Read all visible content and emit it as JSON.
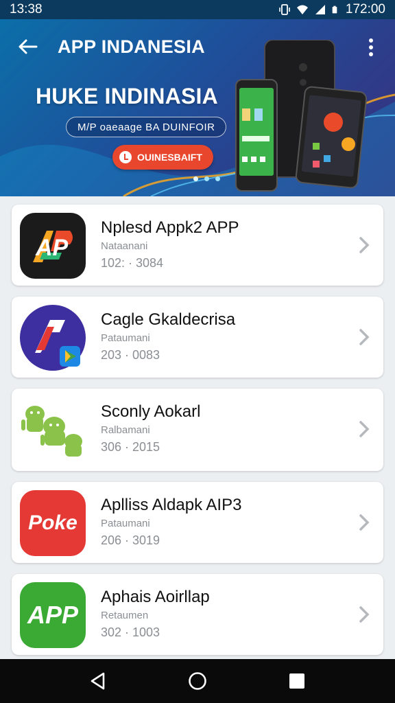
{
  "status_bar": {
    "time": "13:38",
    "clock_right": "172:00",
    "icons": [
      "vibrate-icon",
      "wifi-icon",
      "signal-icon",
      "battery-icon"
    ]
  },
  "header": {
    "title": "APP INDANESIA",
    "back_icon": "arrow-left-icon",
    "menu_icon": "more-vertical-icon",
    "background_colors": [
      "#0b6fa8",
      "#3a2e7c"
    ]
  },
  "banner": {
    "title": "HUKE INDINASIA",
    "subtitle": "M/P oaeaage BA DUINFOIR",
    "cta_label": "OUINESBAIFT",
    "cta_color": "#e9472d",
    "carousel_dots": 3,
    "active_dot": 0
  },
  "apps": [
    {
      "name": "Nplesd Appk2 APP",
      "publisher": "Nataanani",
      "meta": "102: · 3084",
      "icon_text": "AP",
      "icon_bg": "#1b1b1b"
    },
    {
      "name": "Cagle Gkaldecrisa",
      "publisher": "Pataumani",
      "meta": "203 · 0083",
      "icon_text": "A",
      "icon_bg": "#3d2f9f"
    },
    {
      "name": "Sconly Aokarl",
      "publisher": "Ralbamani",
      "meta": "306 · 2015",
      "icon_text": "",
      "icon_bg": "#ffffff"
    },
    {
      "name": "Aplliss Aldapk AIP3",
      "publisher": "Pataumani",
      "meta": "206 · 3019",
      "icon_text": "Poke",
      "icon_bg": "#e53935"
    },
    {
      "name": "Aphais Aoirllap",
      "publisher": "Retaumen",
      "meta": "302 · 1003",
      "icon_text": "APP",
      "icon_bg": "#3aaa35"
    }
  ],
  "nav": {
    "back": "triangle-back-icon",
    "home": "circle-home-icon",
    "recents": "square-recents-icon"
  }
}
